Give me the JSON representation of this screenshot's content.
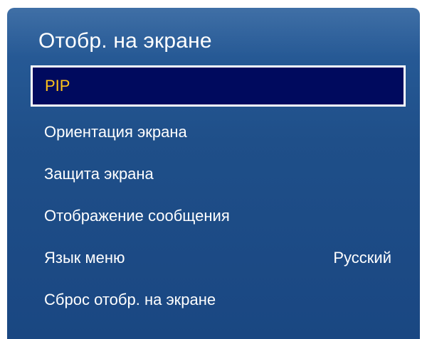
{
  "panel": {
    "title": "Отобр. на экране"
  },
  "menu": {
    "items": [
      {
        "label": "PIP",
        "value": "",
        "selected": true
      },
      {
        "label": "Ориентация экрана",
        "value": ""
      },
      {
        "label": "Защита экрана",
        "value": ""
      },
      {
        "label": "Отображение сообщения",
        "value": ""
      },
      {
        "label": "Язык меню",
        "value": "Русский"
      },
      {
        "label": "Сброс отобр. на экране",
        "value": ""
      }
    ]
  },
  "colors": {
    "panel_background": "#1f4f89",
    "selected_background": "#000a5e",
    "selected_text": "#ffc21a",
    "text": "#ffffff"
  }
}
